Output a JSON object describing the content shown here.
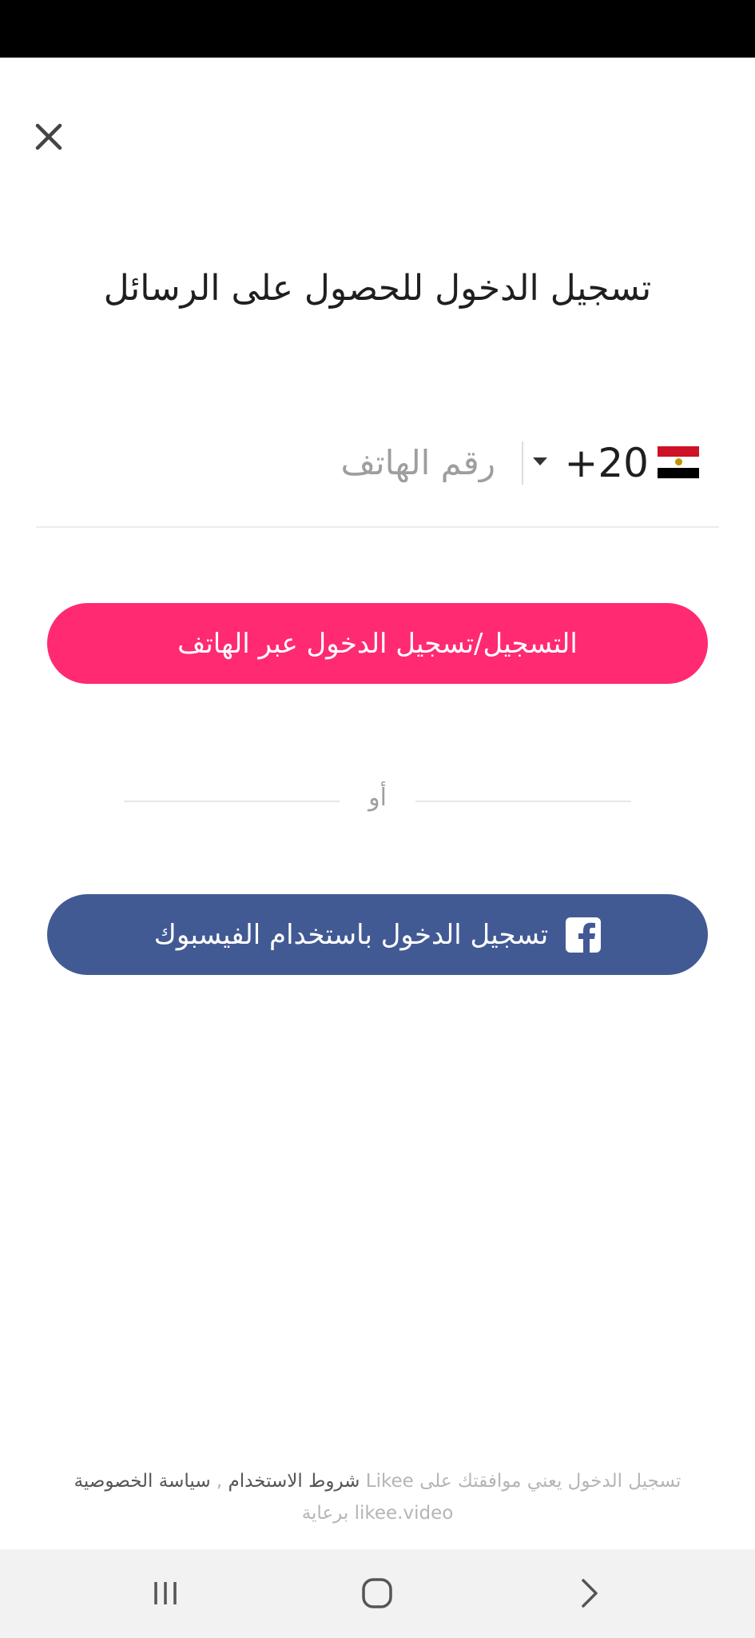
{
  "title": "تسجيل الدخول للحصول على الرسائل",
  "phone": {
    "flag_icon": "egypt-flag-icon",
    "country_code": "+20",
    "placeholder": "رقم الهاتف",
    "value": ""
  },
  "buttons": {
    "phone_login_label": "التسجيل/تسجيل الدخول عبر الهاتف",
    "facebook_login_label": "تسجيل الدخول باستخدام الفيسبوك",
    "facebook_icon": "facebook-icon",
    "close_icon": "close-icon"
  },
  "divider": {
    "or_label": "أو"
  },
  "terms": {
    "prefix": "تسجيل الدخول يعني موافقتك على ",
    "brand": "Likee",
    "terms_link": "شروط الاستخدام",
    "separator": " , ",
    "privacy_link": "سياسة الخصوصية",
    "suffix": "likee.video برعاية"
  },
  "colors": {
    "primary_pink": "#ff2a72",
    "facebook_blue": "#425a94",
    "flag_red": "#ce1126",
    "flag_white": "#ffffff",
    "flag_black": "#000000",
    "flag_gold": "#c09300"
  },
  "nav": {
    "recents_icon": "recents-icon",
    "home_icon": "home-icon",
    "back_icon": "back-chevron-icon"
  }
}
